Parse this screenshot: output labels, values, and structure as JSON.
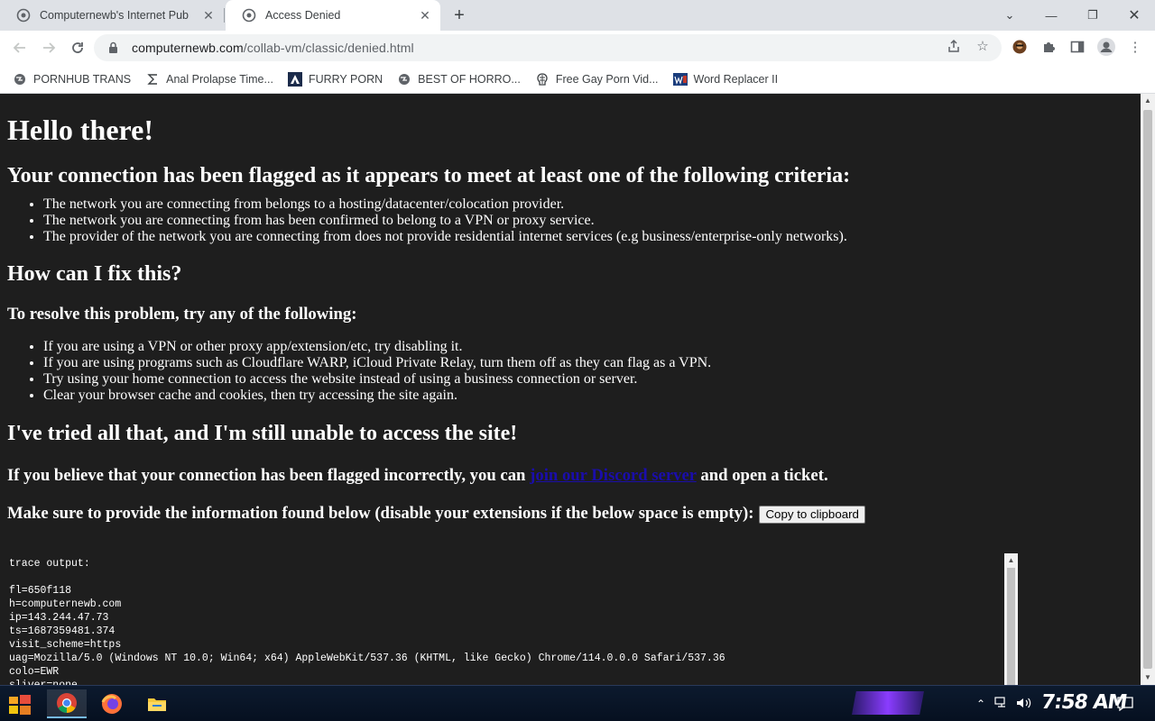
{
  "tabs": [
    {
      "title": "Computernewb's Internet Pub",
      "active": false
    },
    {
      "title": "Access Denied",
      "active": true
    }
  ],
  "toolbar": {
    "url_host": "computernewb.com",
    "url_path": "/collab-vm/classic/denied.html"
  },
  "bookmarks": [
    {
      "label": "PORNHUB TRANS",
      "icon": "globe-icon"
    },
    {
      "label": "Anal Prolapse Time...",
      "icon": "sigma-icon"
    },
    {
      "label": "FURRY PORN",
      "icon": "triangle-logo-icon"
    },
    {
      "label": "BEST OF HORRO...",
      "icon": "globe-icon"
    },
    {
      "label": "Free Gay Porn Vid...",
      "icon": "brain-icon"
    },
    {
      "label": "Word Replacer II",
      "icon": "wr-logo-icon"
    }
  ],
  "page": {
    "heading": "Hello there!",
    "flag_heading": "Your connection has been flagged as it appears to meet at least one of the following criteria:",
    "criteria": [
      "The network you are connecting from belongs to a hosting/datacenter/colocation provider.",
      "The network you are connecting from has been confirmed to belong to a VPN or proxy service.",
      "The provider of the network you are connecting from does not provide residential internet services (e.g business/enterprise-only networks)."
    ],
    "fix_heading": "How can I fix this?",
    "resolve_heading": "To resolve this problem, try any of the following:",
    "fixes": [
      "If you are using a VPN or other proxy app/extension/etc, try disabling it.",
      "If you are using programs such as Cloudflare WARP, iCloud Private Relay, turn them off as they can flag as a VPN.",
      "Try using your home connection to access the website instead of using a business connection or server.",
      "Clear your browser cache and cookies, then try accessing the site again."
    ],
    "tried_heading": "I've tried all that, and I'm still unable to access the site!",
    "incorrect_prefix": "If you believe that your connection has been flagged incorrectly, you can ",
    "incorrect_link": "join our Discord server",
    "incorrect_suffix": " and open a ticket.",
    "provide_text": "Make sure to provide the information found below (disable your extensions if the below space is empty):",
    "copy_label": "Copy to clipboard",
    "trace": "trace output:\n\nfl=650f118\nh=computernewb.com\nip=143.244.47.73\nts=1687359481.374\nvisit_scheme=https\nuag=Mozilla/5.0 (Windows NT 10.0; Win64; x64) AppleWebKit/537.36 (KHTML, like Gecko) Chrome/114.0.0.0 Safari/537.36\ncolo=EWR\nsliver=none"
  },
  "taskbar": {
    "clock": "7:58 AM"
  }
}
